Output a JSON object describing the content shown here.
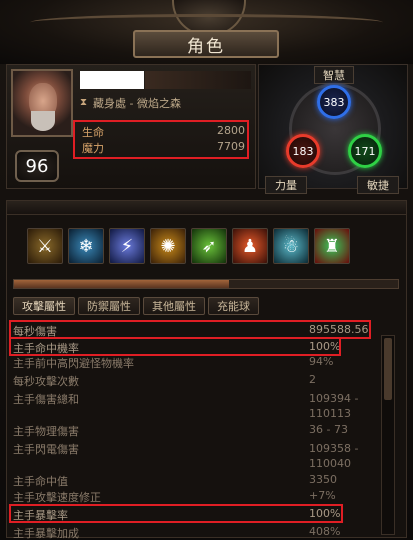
{
  "window": {
    "title": "角色"
  },
  "character": {
    "location": "藏身處 - 微焰之森",
    "level": "96",
    "life_label": "生命",
    "life_value": "2800",
    "mana_label": "魔力",
    "mana_value": "7709"
  },
  "attributes": {
    "intelligence_label": "智慧",
    "intelligence": "383",
    "strength_label": "力量",
    "strength": "183",
    "dexterity_label": "敏捷",
    "dexterity": "171"
  },
  "skills": [
    "sword-skill-icon",
    "ice-skill-icon",
    "lightning-skill-icon",
    "fire-aura-skill-icon",
    "nature-skill-icon",
    "figure-skill-icon",
    "frost-figure-skill-icon",
    "totem-skill-icon"
  ],
  "tabs": [
    "攻擊屬性",
    "防禦屬性",
    "其他屬性",
    "充能球"
  ],
  "stats": [
    {
      "label": "每秒傷害",
      "value": "895588.56"
    },
    {
      "label": "主手命中機率",
      "value": "100%"
    },
    {
      "label": "主手前中高閃避怪物機率",
      "value": "94%"
    },
    {
      "label": "每秒攻擊次數",
      "value": "2"
    },
    {
      "label": "主手傷害總和",
      "value": "109394 - 110113"
    },
    {
      "label": "主手物理傷害",
      "value": "36 - 73"
    },
    {
      "label": "主手閃電傷害",
      "value": "109358 - 110040"
    },
    {
      "label": "主手命中值",
      "value": "3350"
    },
    {
      "label": "主手攻擊速度修正",
      "value": "+7%"
    },
    {
      "label": "主手暴擊率",
      "value": "100%"
    },
    {
      "label": "主手暴擊加成",
      "value": "408%"
    }
  ],
  "colors": {
    "highlight": "#e01e24",
    "intelligence": "#2f6fe8",
    "strength": "#e83b2b",
    "dexterity": "#2fd045"
  }
}
